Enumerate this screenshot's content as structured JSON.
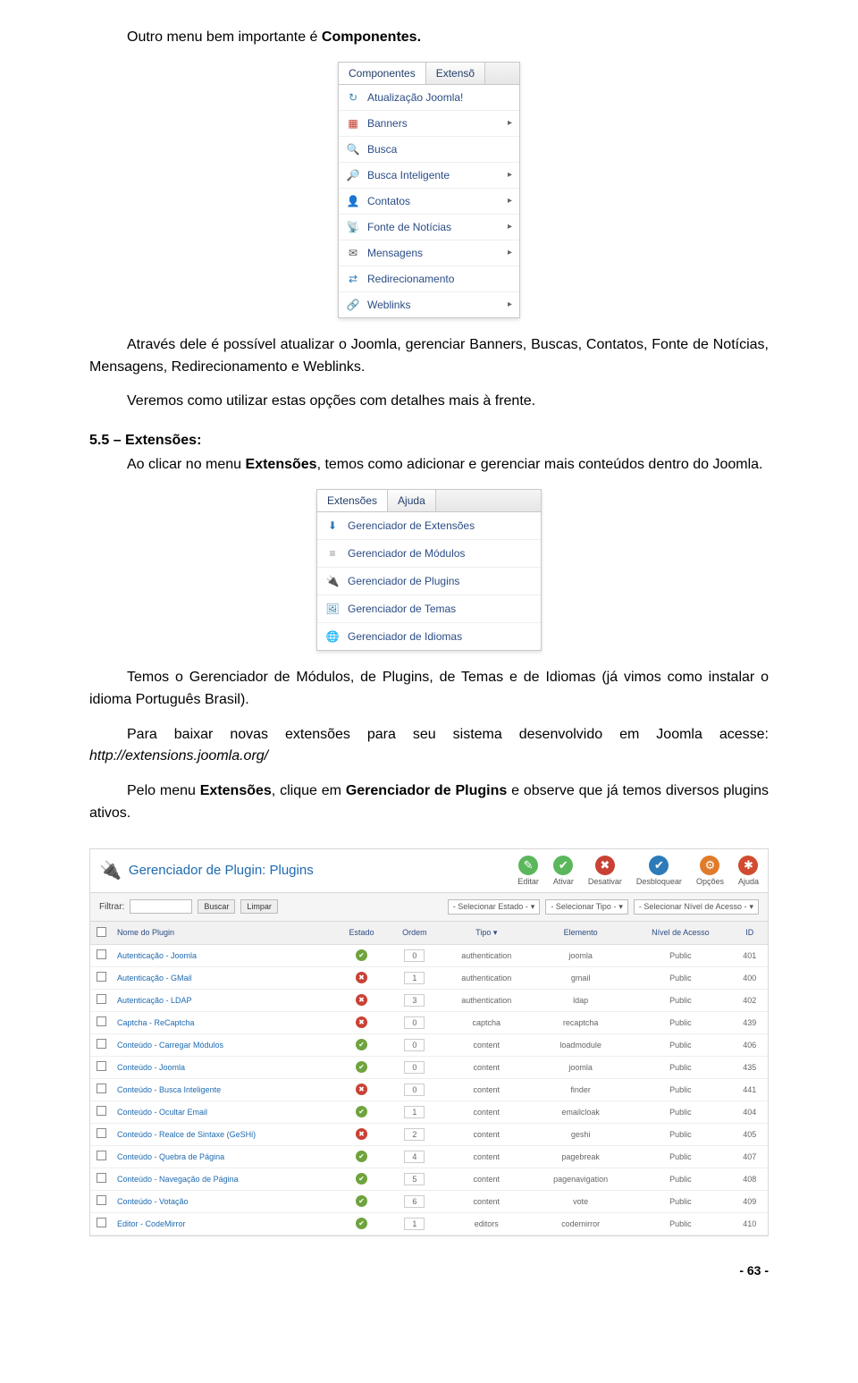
{
  "intro_prefix": "Outro menu bem importante é ",
  "intro_bold": "Componentes.",
  "menu1": {
    "tabs": [
      "Componentes",
      "Extensõ"
    ],
    "items": [
      {
        "icon": "↻",
        "icon_name": "update-icon",
        "color": "#3a87ad",
        "label": "Atualização Joomla!",
        "arrow": false
      },
      {
        "icon": "▦",
        "icon_name": "banners-icon",
        "color": "#c0392b",
        "label": "Banners",
        "arrow": true
      },
      {
        "icon": "🔍",
        "icon_name": "search-icon",
        "color": "#555",
        "label": "Busca",
        "arrow": false
      },
      {
        "icon": "🔎",
        "icon_name": "smart-search-icon",
        "color": "#2e7ab8",
        "label": "Busca Inteligente",
        "arrow": true
      },
      {
        "icon": "👤",
        "icon_name": "contacts-icon",
        "color": "#2e7ab8",
        "label": "Contatos",
        "arrow": true
      },
      {
        "icon": "📡",
        "icon_name": "rss-icon",
        "color": "#e07b2a",
        "label": "Fonte de Notícias",
        "arrow": true
      },
      {
        "icon": "✉",
        "icon_name": "messages-icon",
        "color": "#555",
        "label": "Mensagens",
        "arrow": true
      },
      {
        "icon": "⇄",
        "icon_name": "redirect-icon",
        "color": "#2e7ab8",
        "label": "Redirecionamento",
        "arrow": false
      },
      {
        "icon": "🔗",
        "icon_name": "weblinks-icon",
        "color": "#3a87ad",
        "label": "Weblinks",
        "arrow": true
      }
    ]
  },
  "para2": "Através dele é possível atualizar o Joomla, gerenciar Banners, Buscas, Contatos, Fonte de Notícias, Mensagens, Redirecionamento e Weblinks.",
  "para3": "Veremos como utilizar estas opções com detalhes mais à frente.",
  "section55": "5.5 – Extensões:",
  "para4_prefix": "Ao clicar no menu ",
  "para4_bold": "Extensões",
  "para4_suffix": ", temos como adicionar e gerenciar mais conteúdos dentro do Joomla.",
  "menu2": {
    "tabs": [
      "Extensões",
      "Ajuda"
    ],
    "items": [
      {
        "icon": "⬇",
        "icon_name": "download-icon",
        "color": "#2e7ab8",
        "label": "Gerenciador de Extensões"
      },
      {
        "icon": "≡",
        "icon_name": "modules-icon",
        "color": "#8a8a8a",
        "label": "Gerenciador de Módulos"
      },
      {
        "icon": "🔌",
        "icon_name": "plugins-icon",
        "color": "#e07b2a",
        "label": "Gerenciador de Plugins"
      },
      {
        "icon": "🖼",
        "icon_name": "themes-icon",
        "color": "#3a87ad",
        "label": "Gerenciador de Temas"
      },
      {
        "icon": "🌐",
        "icon_name": "languages-icon",
        "color": "#4b8b3b",
        "label": "Gerenciador de Idiomas"
      }
    ]
  },
  "para5": "Temos o Gerenciador de Módulos, de Plugins, de Temas e de Idiomas (já vimos como instalar o idioma Português Brasil).",
  "para6_prefix": "Para baixar novas extensões para seu sistema desenvolvido em Joomla acesse: ",
  "para6_link": "http://extensions.joomla.org/",
  "para7_prefix": "Pelo menu ",
  "para7_bold1": "Extensões",
  "para7_mid": ", clique em ",
  "para7_bold2": "Gerenciador de Plugins",
  "para7_suffix": " e observe que já temos diversos plugins ativos.",
  "pluginPanel": {
    "title": "Gerenciador de Plugin: Plugins",
    "tools": [
      {
        "name": "editar-tool",
        "icon": "✎",
        "bg": "#5bb75b",
        "label": "Editar"
      },
      {
        "name": "ativar-tool",
        "icon": "✔",
        "bg": "#5bb75b",
        "label": "Ativar"
      },
      {
        "name": "desativar-tool",
        "icon": "✖",
        "bg": "#c94135",
        "label": "Desativar"
      },
      {
        "name": "desbloquear-tool",
        "icon": "✔",
        "bg": "#2e7ab8",
        "label": "Desbloquear"
      },
      {
        "name": "opcoes-tool",
        "icon": "⚙",
        "bg": "#e07b2a",
        "label": "Opções"
      },
      {
        "name": "ajuda-tool",
        "icon": "✱",
        "bg": "#d04b2f",
        "label": "Ajuda"
      }
    ],
    "filter": {
      "label": "Filtrar:",
      "buscar": "Buscar",
      "limpar": "Limpar",
      "sel_estado": "- Selecionar Estado -",
      "sel_tipo": "- Selecionar Tipo -",
      "sel_acesso": "- Selecionar Nível de Acesso -"
    },
    "headers": [
      "",
      "Nome do Plugin",
      "Estado",
      "Ordem",
      "Tipo ▾",
      "Elemento",
      "Nível de Acesso",
      "ID"
    ],
    "rows": [
      {
        "name": "Autenticação - Joomla",
        "on": true,
        "ord": "0",
        "tipo": "authentication",
        "elem": "joomla",
        "acc": "Public",
        "id": "401"
      },
      {
        "name": "Autenticação - GMail",
        "on": false,
        "ord": "1",
        "tipo": "authentication",
        "elem": "gmail",
        "acc": "Public",
        "id": "400"
      },
      {
        "name": "Autenticação - LDAP",
        "on": false,
        "ord": "3",
        "tipo": "authentication",
        "elem": "ldap",
        "acc": "Public",
        "id": "402"
      },
      {
        "name": "Captcha - ReCaptcha",
        "on": false,
        "ord": "0",
        "tipo": "captcha",
        "elem": "recaptcha",
        "acc": "Public",
        "id": "439"
      },
      {
        "name": "Conteúdo - Carregar Módulos",
        "on": true,
        "ord": "0",
        "tipo": "content",
        "elem": "loadmodule",
        "acc": "Public",
        "id": "406"
      },
      {
        "name": "Conteúdo - Joomla",
        "on": true,
        "ord": "0",
        "tipo": "content",
        "elem": "joomla",
        "acc": "Public",
        "id": "435"
      },
      {
        "name": "Conteúdo - Busca Inteligente",
        "on": false,
        "ord": "0",
        "tipo": "content",
        "elem": "finder",
        "acc": "Public",
        "id": "441"
      },
      {
        "name": "Conteúdo - Ocultar Email",
        "on": true,
        "ord": "1",
        "tipo": "content",
        "elem": "emailcloak",
        "acc": "Public",
        "id": "404"
      },
      {
        "name": "Conteúdo - Realce de Sintaxe (GeSHi)",
        "on": false,
        "ord": "2",
        "tipo": "content",
        "elem": "geshi",
        "acc": "Public",
        "id": "405"
      },
      {
        "name": "Conteúdo - Quebra de Página",
        "on": true,
        "ord": "4",
        "tipo": "content",
        "elem": "pagebreak",
        "acc": "Public",
        "id": "407"
      },
      {
        "name": "Conteúdo - Navegação de Página",
        "on": true,
        "ord": "5",
        "tipo": "content",
        "elem": "pagenavigation",
        "acc": "Public",
        "id": "408"
      },
      {
        "name": "Conteúdo - Votação",
        "on": true,
        "ord": "6",
        "tipo": "content",
        "elem": "vote",
        "acc": "Public",
        "id": "409"
      },
      {
        "name": "Editor - CodeMirror",
        "on": true,
        "ord": "1",
        "tipo": "editors",
        "elem": "codemirror",
        "acc": "Public",
        "id": "410"
      }
    ]
  },
  "page_number": "- 63 -"
}
